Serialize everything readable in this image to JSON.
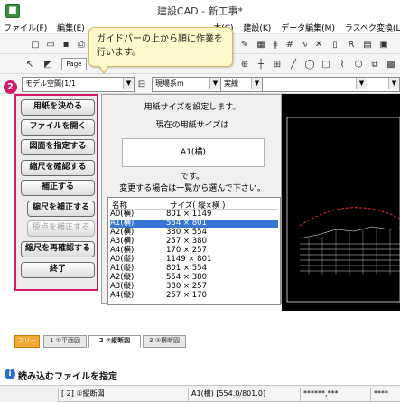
{
  "window": {
    "title": "建設CAD - 新工事*"
  },
  "menu": [
    "ファイル(F)",
    "編集(E)",
    "",
    "",
    "",
    "",
    "木(C)",
    "建設(K)",
    "データ編集(M)",
    "ラスベク変換(L)"
  ],
  "toolbar": {
    "page_label": "Page",
    "model_combo": "モデル空間(1/1",
    "layer_combo": "現場系m",
    "line_combo": "実線"
  },
  "callout": {
    "text": "ガイドバーの上から順に作業を行います。"
  },
  "step_badge": "2",
  "guide": {
    "buttons": [
      {
        "label": "用紙を決める",
        "enabled": true
      },
      {
        "label": "ファイルを開く",
        "enabled": true
      },
      {
        "label": "図面を指定する",
        "enabled": true
      },
      {
        "label": "縮尺を確認する",
        "enabled": true
      },
      {
        "label": "補正する",
        "enabled": true
      },
      {
        "label": "縮尺を補正する",
        "enabled": true
      },
      {
        "label": "原点を補正する",
        "enabled": false
      },
      {
        "label": "縮尺を再確認する",
        "enabled": true
      },
      {
        "label": "終了",
        "enabled": true
      }
    ]
  },
  "dialog": {
    "line1": "用紙サイズを設定します。",
    "line2": "現在の用紙サイズは",
    "current_size": "A1(横)",
    "line3": "です。",
    "line4": "変更する場合は一覧から選んで下さい。",
    "col_name": "名称",
    "col_size": "サイズ( 縦×横 )",
    "rows": [
      {
        "name": "A0(横)",
        "size": "801 × 1149",
        "selected": false
      },
      {
        "name": "A1(横)",
        "size": "554 × 801",
        "selected": true
      },
      {
        "name": "A2(横)",
        "size": "380 × 554",
        "selected": false
      },
      {
        "name": "A3(横)",
        "size": "257 × 380",
        "selected": false
      },
      {
        "name": "A4(横)",
        "size": "170 × 257",
        "selected": false
      },
      {
        "name": "A0(縦)",
        "size": "1149 × 801",
        "selected": false
      },
      {
        "name": "A1(縦)",
        "size": "801 × 554",
        "selected": false
      },
      {
        "name": "A2(縦)",
        "size": "554 × 380",
        "selected": false
      },
      {
        "name": "A3(縦)",
        "size": "380 × 257",
        "selected": false
      },
      {
        "name": "A4(縦)",
        "size": "257 × 170",
        "selected": false
      }
    ]
  },
  "tabs": [
    {
      "label": "フリー",
      "type": "free"
    },
    {
      "label": "1 ①平面図",
      "type": "normal"
    },
    {
      "label": "2 ②縦断図",
      "type": "active"
    },
    {
      "label": "3 ③横断図",
      "type": "normal"
    }
  ],
  "status": {
    "message": "読み込むファイルを指定",
    "cells": [
      "[ 2] ②縦断図",
      "A1(横) [554.0/801.0]",
      "******,***",
      "****"
    ]
  }
}
